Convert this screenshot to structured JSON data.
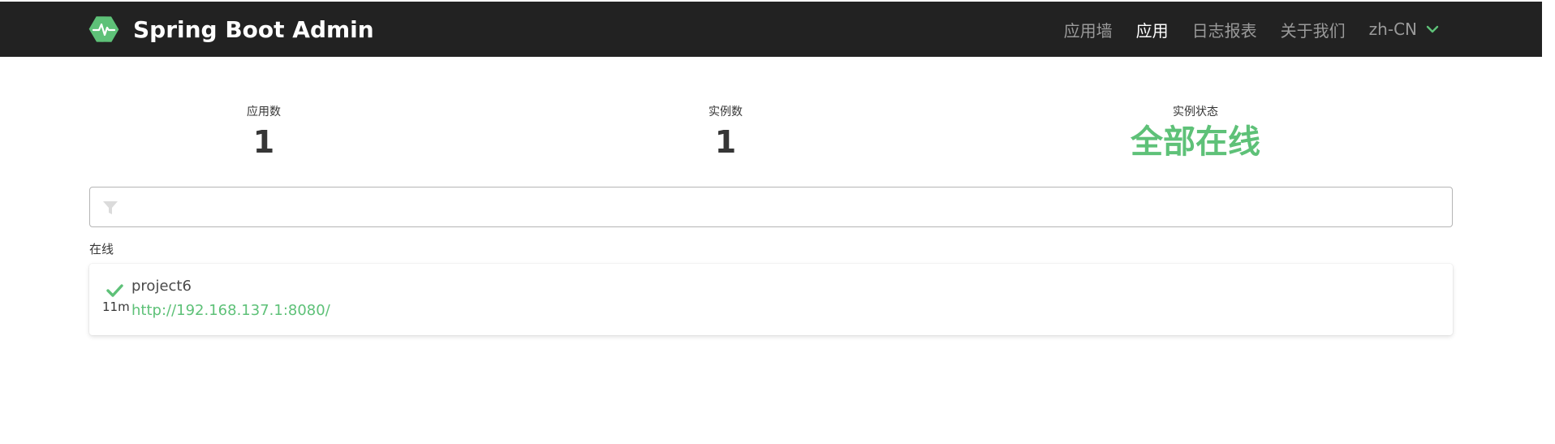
{
  "header": {
    "title": "Spring Boot Admin",
    "nav": [
      {
        "label": "应用墙",
        "active": false
      },
      {
        "label": "应用",
        "active": true
      },
      {
        "label": "日志报表",
        "active": false
      },
      {
        "label": "关于我们",
        "active": false
      }
    ],
    "language": "zh-CN"
  },
  "stats": {
    "applications": {
      "label": "应用数",
      "value": "1"
    },
    "instances": {
      "label": "实例数",
      "value": "1"
    },
    "status": {
      "label": "实例状态",
      "value": "全部在线"
    }
  },
  "filter": {
    "placeholder": ""
  },
  "groups": [
    {
      "label": "在线",
      "apps": [
        {
          "name": "project6",
          "url": "http://192.168.137.1:8080/",
          "since": "11m"
        }
      ]
    }
  ],
  "colors": {
    "navbar": "#222222",
    "brand_accent": "#6db33f",
    "status_up": "#5ec178",
    "nav_inactive": "#9a9a9a"
  }
}
